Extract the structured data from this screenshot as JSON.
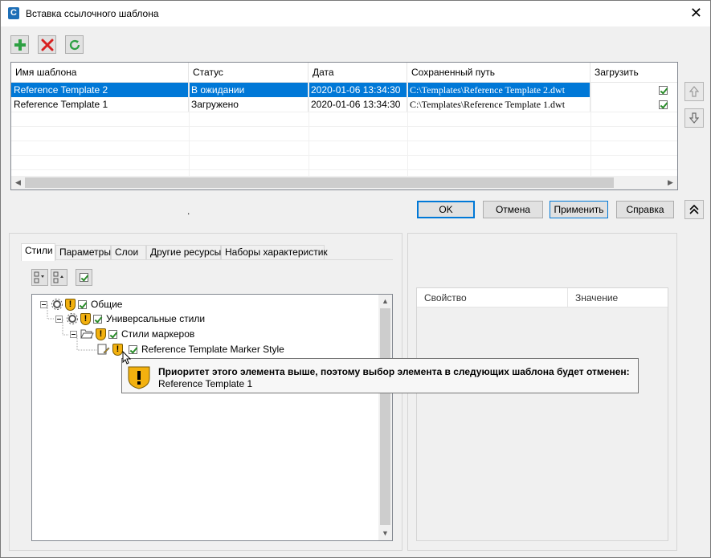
{
  "window": {
    "title": "Вставка ссылочного шаблона",
    "close_glyph": "✕"
  },
  "toolbar": {
    "add_icon": "plus-icon",
    "delete_icon": "delete-x-icon",
    "refresh_icon": "refresh-icon"
  },
  "templates_table": {
    "columns": [
      "Имя шаблона",
      "Статус",
      "Дата",
      "Сохраненный путь",
      "Загрузить"
    ],
    "rows": [
      {
        "name": "Reference Template 2",
        "status": "В ожидании",
        "date": "2020-01-06 13:34:30",
        "path": "C:\\Templates\\Reference Template 2.dwt",
        "load": true,
        "selected": true
      },
      {
        "name": "Reference Template 1",
        "status": "Загружено",
        "date": "2020-01-06 13:34:30",
        "path": "C:\\Templates\\Reference Template 1.dwt",
        "load": true,
        "selected": false
      }
    ]
  },
  "side_buttons": {
    "up_icon": "arrow-up-icon",
    "down_icon": "arrow-down-icon",
    "collapse_icon": "double-chevron-up-icon"
  },
  "dot": ".",
  "buttons": {
    "ok": "OK",
    "cancel": "Отмена",
    "apply": "Применить",
    "help": "Справка"
  },
  "tabs": [
    "Стили",
    "Параметры",
    "Слои",
    "Другие ресурсы",
    "Наборы характеристик"
  ],
  "tree": {
    "nodes": [
      {
        "label": "Общие",
        "level": 0
      },
      {
        "label": "Универсальные стили",
        "level": 1
      },
      {
        "label": "Стили маркеров",
        "level": 2
      },
      {
        "label": "Reference Template Marker Style",
        "level": 3
      }
    ]
  },
  "tooltip": {
    "title": "Приоритет этого элемента выше, поэтому выбор элемента в следующих шаблона будет отменен:",
    "body": "Reference Template 1"
  },
  "properties": {
    "columns": [
      "Свойство",
      "Значение"
    ]
  },
  "colors": {
    "selection": "#0078d7",
    "warning": "#f3b10f",
    "add_green": "#2ea043",
    "delete_red": "#d82020"
  }
}
